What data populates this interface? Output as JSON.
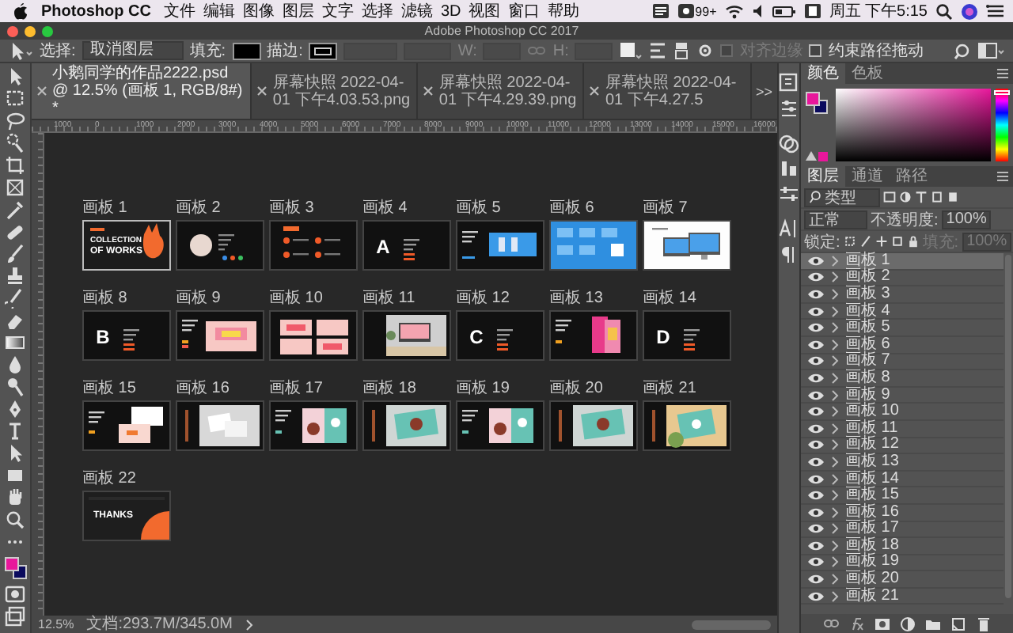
{
  "menu_bar": {
    "app": "Photoshop CC",
    "items": [
      "文件",
      "编辑",
      "图像",
      "图层",
      "文字",
      "选择",
      "滤镜",
      "3D",
      "视图",
      "窗口",
      "帮助"
    ],
    "badge": "99+",
    "clock": "周五 下午5:15"
  },
  "window": {
    "title": "Adobe Photoshop CC 2017"
  },
  "options_bar": {
    "select_label": "选择:",
    "select_value": "取消图层",
    "fill_label": "填充:",
    "stroke_label": "描边:",
    "w_label": "W:",
    "h_label": "H:",
    "checkboxes": [
      {
        "label": "对齐边缘",
        "checked": false,
        "disabled": true
      },
      {
        "label": "约束路径拖动",
        "checked": false,
        "disabled": false
      }
    ]
  },
  "tabs": [
    {
      "label": "小鹅同学的作品2222.psd @ 12.5% (画板 1, RGB/8#) *",
      "selected": true
    },
    {
      "label": "屏幕快照 2022-04-01 下午4.03.53.png",
      "selected": false
    },
    {
      "label": "屏幕快照 2022-04-01 下午4.29.39.png",
      "selected": false
    },
    {
      "label": "屏幕快照 2022-04-01 下午4.27.5",
      "selected": false
    }
  ],
  "tabs_overflow": ">>",
  "ruler": {
    "labels": [
      "1000",
      "0",
      "1000",
      "2000",
      "3000",
      "4000",
      "5000",
      "6000",
      "7000",
      "8000",
      "9000",
      "10000",
      "11000",
      "12000",
      "13000",
      "14000",
      "15000",
      "16000"
    ]
  },
  "artboards": [
    {
      "label": "画板 1",
      "selected": true,
      "kind": "cover",
      "lines": [
        "COLLECTION",
        "OF WORKS"
      ]
    },
    {
      "label": "画板 2",
      "selected": false,
      "kind": "profile"
    },
    {
      "label": "画板 3",
      "selected": false,
      "kind": "list"
    },
    {
      "label": "画板 4",
      "selected": false,
      "kind": "letter",
      "lines": [
        "A"
      ]
    },
    {
      "label": "画板 5",
      "selected": false,
      "kind": "blue"
    },
    {
      "label": "画板 6",
      "selected": false,
      "kind": "bluegrid"
    },
    {
      "label": "画板 7",
      "selected": false,
      "kind": "monitor"
    },
    {
      "label": "画板 8",
      "selected": false,
      "kind": "letter",
      "lines": [
        "B"
      ]
    },
    {
      "label": "画板 9",
      "selected": false,
      "kind": "pink"
    },
    {
      "label": "画板 10",
      "selected": false,
      "kind": "pink4"
    },
    {
      "label": "画板 11",
      "selected": false,
      "kind": "room"
    },
    {
      "label": "画板 12",
      "selected": false,
      "kind": "letter",
      "lines": [
        "C"
      ]
    },
    {
      "label": "画板 13",
      "selected": false,
      "kind": "poster"
    },
    {
      "label": "画板 14",
      "selected": false,
      "kind": "letter",
      "lines": [
        "D"
      ]
    },
    {
      "label": "画板 15",
      "selected": false,
      "kind": "cards"
    },
    {
      "label": "画板 16",
      "selected": false,
      "kind": "mockup"
    },
    {
      "label": "画板 17",
      "selected": false,
      "kind": "teal"
    },
    {
      "label": "画板 18",
      "selected": false,
      "kind": "tealmock"
    },
    {
      "label": "画板 19",
      "selected": false,
      "kind": "teal"
    },
    {
      "label": "画板 20",
      "selected": false,
      "kind": "tealmock"
    },
    {
      "label": "画板 21",
      "selected": false,
      "kind": "food"
    },
    {
      "label": "画板 22",
      "selected": false,
      "kind": "thanks",
      "lines": [
        "THANKS"
      ]
    }
  ],
  "status_bar": {
    "zoom": "12.5%",
    "document": "文档:293.7M/345.0M"
  },
  "swatches": [
    {
      "color": "#e8179b"
    },
    {
      "color": "#0b0b5e"
    }
  ],
  "color_panel": {
    "tabs": [
      {
        "label": "颜色",
        "selected": true
      },
      {
        "label": "色板",
        "selected": false
      }
    ],
    "hue_slider": {
      "level": 0.97
    }
  },
  "layers_panel": {
    "tabs": [
      {
        "label": "图层",
        "selected": true
      },
      {
        "label": "通道",
        "selected": false
      },
      {
        "label": "路径",
        "selected": false
      }
    ],
    "filter": "类型",
    "blend_mode": "正常",
    "opacity_label": "不透明度:",
    "opacity": "100%",
    "lock_label": "锁定:",
    "fill_label": "填充:",
    "fill": "100%",
    "layers": [
      {
        "name": "画板 1",
        "selected": true,
        "visible": true
      },
      {
        "name": "画板 2",
        "selected": false,
        "visible": true
      },
      {
        "name": "画板 3",
        "selected": false,
        "visible": true
      },
      {
        "name": "画板 4",
        "selected": false,
        "visible": true
      },
      {
        "name": "画板 5",
        "selected": false,
        "visible": true
      },
      {
        "name": "画板 6",
        "selected": false,
        "visible": true
      },
      {
        "name": "画板 7",
        "selected": false,
        "visible": true
      },
      {
        "name": "画板 8",
        "selected": false,
        "visible": true
      },
      {
        "name": "画板 9",
        "selected": false,
        "visible": true
      },
      {
        "name": "画板 10",
        "selected": false,
        "visible": true
      },
      {
        "name": "画板 11",
        "selected": false,
        "visible": true
      },
      {
        "name": "画板 12",
        "selected": false,
        "visible": true
      },
      {
        "name": "画板 13",
        "selected": false,
        "visible": true
      },
      {
        "name": "画板 14",
        "selected": false,
        "visible": true
      },
      {
        "name": "画板 15",
        "selected": false,
        "visible": true
      },
      {
        "name": "画板 16",
        "selected": false,
        "visible": true
      },
      {
        "name": "画板 17",
        "selected": false,
        "visible": true
      },
      {
        "name": "画板 18",
        "selected": false,
        "visible": true
      },
      {
        "name": "画板 19",
        "selected": false,
        "visible": true
      },
      {
        "name": "画板 20",
        "selected": false,
        "visible": true
      },
      {
        "name": "画板 21",
        "selected": false,
        "visible": true
      }
    ]
  }
}
